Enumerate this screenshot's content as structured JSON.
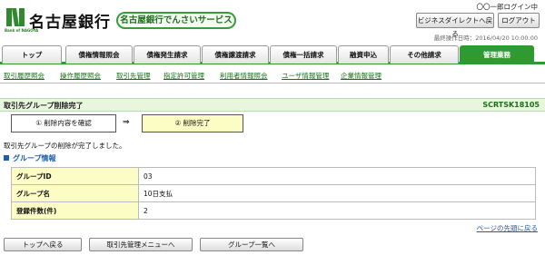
{
  "header": {
    "logo_text": "名古屋銀行",
    "logo_sub": "Bank of NAGOYA",
    "service_name": "名古屋銀行でんさいサービス",
    "user_name": "〇〇一郎ログイン中",
    "biz_direct_label": "ビジネスダイレクトへ戻る",
    "logout_label": "ログアウト",
    "last_operation": "最終操作日時：2016/04/20 10:00:00"
  },
  "tabs": [
    {
      "label": "トップ"
    },
    {
      "label": "債権情報照会"
    },
    {
      "label": "債権発生請求"
    },
    {
      "label": "債権譲渡請求"
    },
    {
      "label": "債権一括請求"
    },
    {
      "label": "融資申込"
    },
    {
      "label": "その他請求"
    },
    {
      "label": "管理業務",
      "active": true
    }
  ],
  "subnav": [
    {
      "label": "取引履歴照会"
    },
    {
      "label": "操作履歴照会"
    },
    {
      "label": "取引先管理"
    },
    {
      "label": "指定許可管理"
    },
    {
      "label": "利用者情報照会"
    },
    {
      "label": "ユーザ情報管理"
    },
    {
      "label": "企業情報管理"
    }
  ],
  "page": {
    "title": "取引先グループ削除完了",
    "screen_id": "SCRTSK18105",
    "step1": "① 削除内容を確認",
    "step_arrow": "⇒",
    "step2": "② 削除完了",
    "complete_message": "取引先グループの削除が完了しました。",
    "section_title": "グループ情報"
  },
  "group_info": [
    {
      "label": "グループID",
      "value": "03"
    },
    {
      "label": "グループ名",
      "value": "10日支払"
    },
    {
      "label": "登録件数(件)",
      "value": "2"
    }
  ],
  "footer": {
    "page_top": "ページの先頭に戻る",
    "btn_top": "トップへ戻る",
    "btn_partner_menu": "取引先管理メニューへ",
    "btn_group_list": "グループ一覧へ"
  },
  "colors": {
    "accent_green": "#2f9a2f",
    "highlight_yellow": "#fcfdc4",
    "section_blue": "#1c5ea8"
  }
}
